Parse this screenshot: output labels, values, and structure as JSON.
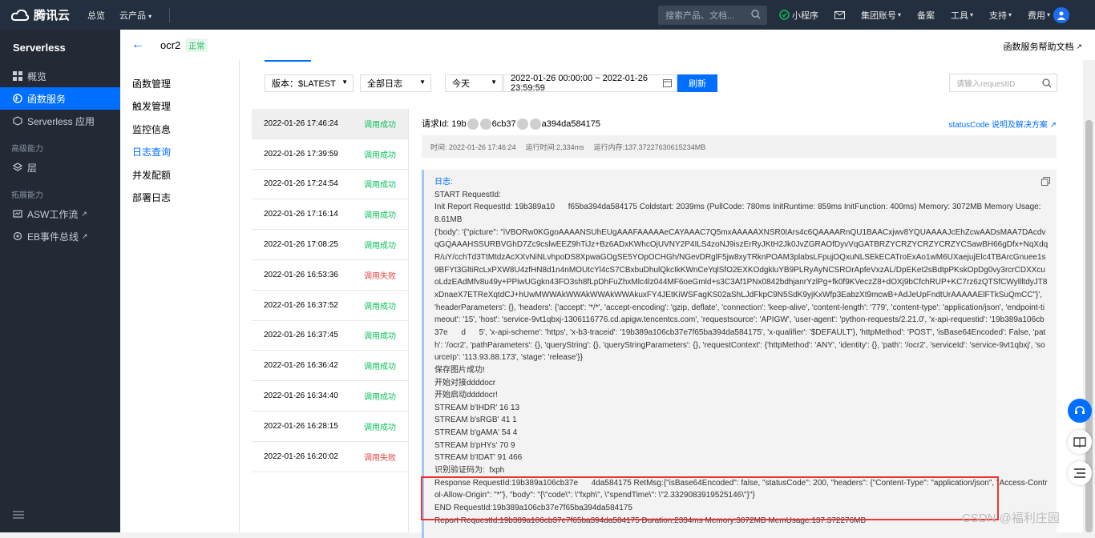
{
  "topbar": {
    "logo_text": "腾讯云",
    "nav": [
      "总览",
      "云产品"
    ],
    "search_placeholder": "搜索产品、文档...",
    "right_items": [
      "小程序",
      "集团账号",
      "备案",
      "工具",
      "支持",
      "费用"
    ]
  },
  "sidebar": {
    "title": "Serverless",
    "items_top": [
      {
        "label": "概览",
        "icon": "grid-icon"
      },
      {
        "label": "函数服务",
        "icon": "function-icon",
        "active": true
      },
      {
        "label": "Serverless 应用",
        "icon": "cube-icon"
      }
    ],
    "group1": "高级能力",
    "items_mid": [
      {
        "label": "层",
        "icon": "layers-icon"
      }
    ],
    "group2": "拓展能力",
    "items_ext": [
      {
        "label": "ASW工作流",
        "icon": "workflow-icon"
      },
      {
        "label": "EB事件总线",
        "icon": "eventbus-icon"
      }
    ]
  },
  "header": {
    "function_name": "ocr2",
    "status": "正常",
    "help_doc": "函数服务帮助文档"
  },
  "fn_menu": [
    "函数管理",
    "触发管理",
    "监控信息",
    "日志查询",
    "并发配额",
    "部署日志"
  ],
  "fn_menu_selected": 3,
  "filters": {
    "version": "版本：$LATEST",
    "log_type": "全部日志",
    "range": "今天",
    "datetime": "2022-01-26 00:00:00 ~ 2022-01-26 23:59:59",
    "refresh": "刷新",
    "request_placeholder": "请输入requestID"
  },
  "log_list": [
    {
      "time": "2022-01-26 17:46:24",
      "status": "调用成功",
      "ok": true
    },
    {
      "time": "2022-01-26 17:39:59",
      "status": "调用成功",
      "ok": true
    },
    {
      "time": "2022-01-26 17:24:54",
      "status": "调用成功",
      "ok": true
    },
    {
      "time": "2022-01-26 17:16:14",
      "status": "调用成功",
      "ok": true
    },
    {
      "time": "2022-01-26 17:08:25",
      "status": "调用成功",
      "ok": true
    },
    {
      "time": "2022-01-26 16:53:36",
      "status": "调用失败",
      "ok": false
    },
    {
      "time": "2022-01-26 16:37:52",
      "status": "调用成功",
      "ok": true
    },
    {
      "time": "2022-01-26 16:37:45",
      "status": "调用成功",
      "ok": true
    },
    {
      "time": "2022-01-26 16:36:42",
      "status": "调用成功",
      "ok": true
    },
    {
      "time": "2022-01-26 16:34:40",
      "status": "调用成功",
      "ok": true
    },
    {
      "time": "2022-01-26 16:28:15",
      "status": "调用成功",
      "ok": true
    },
    {
      "time": "2022-01-26 16:20:02",
      "status": "调用失败",
      "ok": false
    }
  ],
  "detail": {
    "request_prefix": "请求Id:  19b",
    "request_mid": "6cb37",
    "request_suffix": "a394da584175",
    "status_link": "statusCode 说明及解决方案",
    "meta_time": "时间: 2022-01-26 17:46:24",
    "meta_runtime": "运行时间:2,334ms",
    "meta_memory": "运行内存:137.37227630615234MB",
    "log_title": "日志:",
    "log_lines": [
      "START RequestId:",
      "Init Report RequestId: 19b389a10      f65ba394da584175 Coldstart: 2039ms (PullCode: 780ms InitRuntime: 859ms InitFunction: 400ms) Memory: 3072MB Memory Usage: 8.61MB",
      "{'body': '{\"picture\": \"iVBORw0KGgoAAAANSUhEUgAAAFAAAAAeCAYAAAC7Q5mxAAAAAXNSR0IArs4c6QAAAARnQU1BAACxjwv8YQUAAAAJcEhZcwAADsMAA7DAcdvqGQAAAHSSURBVGhD7Zc9cslwEEZ9hTiJz+Bz6ADxKWhcOjUVNY2P4ILS4zoNJ9iszErRyJKtH2Jk0JvZGRAOfDyvVqGATBRZYCRZYCRZYCRZYCSawBH66gDfx+NqXdqR/uY/cchTd3TtMtdzAcXXvNiNLvhpoDS8XpwaGOgSE5YOpOCHGh/NGevDRglF5jw8xyTRknPOAM3plabsLFpujOQxuNLSEkECATroExAo1wM6UXaejujElc4TBArcGnuee1s9BFYt3GltiRcLxPXW8U4zfHN8d1n4nMOUtcYl4cS7CBxbuDhulQkcIkKWnCeYqlSfO2EXKOdgkluYB9PLRyAyNCSROrApfeVxzAL/DpEKet2sBdtpPKskOpDg0vy3rcrCDXXcuoLdzEAdMfv8u49y+PPiwUGgkn43FO3sh8fLpDhFuZhxMlc4lz044MF6oeGmld+s3C3Af1PNx0842bdhjanrYzlPg+fk0f9KVeczZ8+dOXj9bCfchRUP+KC7rz6zQTSfCWyllltdyJT8xDnaeX7ETReXqtdCJ+hUwMWWAkWWAkWWAkWWAkuxFY4JEtKiWSFagKS02aShLJdFkpC9N5SdK9yjKxWfp3EabzXt9mcwB+AdJeUpFndtUrAAAAAElFTkSuQmCC\"}', 'headerParameters': {}, 'headers': {'accept': '*/*', 'accept-encoding': 'gzip, deflate', 'connection': 'keep-alive', 'content-length': '779', 'content-type': 'application/json', 'endpoint-timeout': '15', 'host': 'service-9vt1qbxj-1306116776.cd.apigw.tencentcs.com', 'requestsource': 'APIGW', 'user-agent': 'python-requests/2.21.0', 'x-api-requestid': '19b389a106cb37e      d      5', 'x-api-scheme': 'https', 'x-b3-traceid': '19b389a106cb37e7f65ba394da584175', 'x-qualifier': '$DEFAULT'}, 'httpMethod': 'POST', 'isBase64Encoded': False, 'path': '/ocr2', 'pathParameters': {}, 'queryString': {}, 'queryStringParameters': {}, 'requestContext': {'httpMethod': 'ANY', 'identity': {}, 'path': '/ocr2', 'serviceId': 'service-9vt1qbxj', 'sourceIp': '113.93.88.173', 'stage': 'release'}}",
      "保存图片成功!",
      "开始对接ddddocr",
      "开始启动ddddocr!",
      "STREAM b'IHDR' 16 13",
      "STREAM b'sRGB' 41 1",
      "STREAM b'gAMA' 54 4",
      "STREAM b'pHYs' 70 9",
      "STREAM b'IDAT' 91 466",
      "识别验证码为:  fxph",
      "Response RequestId:19b389a106cb37e      4da584175 RetMsg:{\"isBase64Encoded\": false, \"statusCode\": 200, \"headers\": {\"Content-Type\": \"application/json\", \"Access-Control-Allow-Origin\": \"*\"}, \"body\": \"{\\\"code\\\": \\\"fxph\\\", \\\"spendTime\\\": \\\"2.3329083919525146\\\"}\"}",
      "END RequestId:19b389a106cb37e7f65ba394da584175",
      "Report RequestId:19b389a106cb37e7f65ba394da584175 Duration:2334ms Memory:3072MB MemUsage:137.372276MB"
    ]
  },
  "watermark": "CSDN @福利庄园"
}
